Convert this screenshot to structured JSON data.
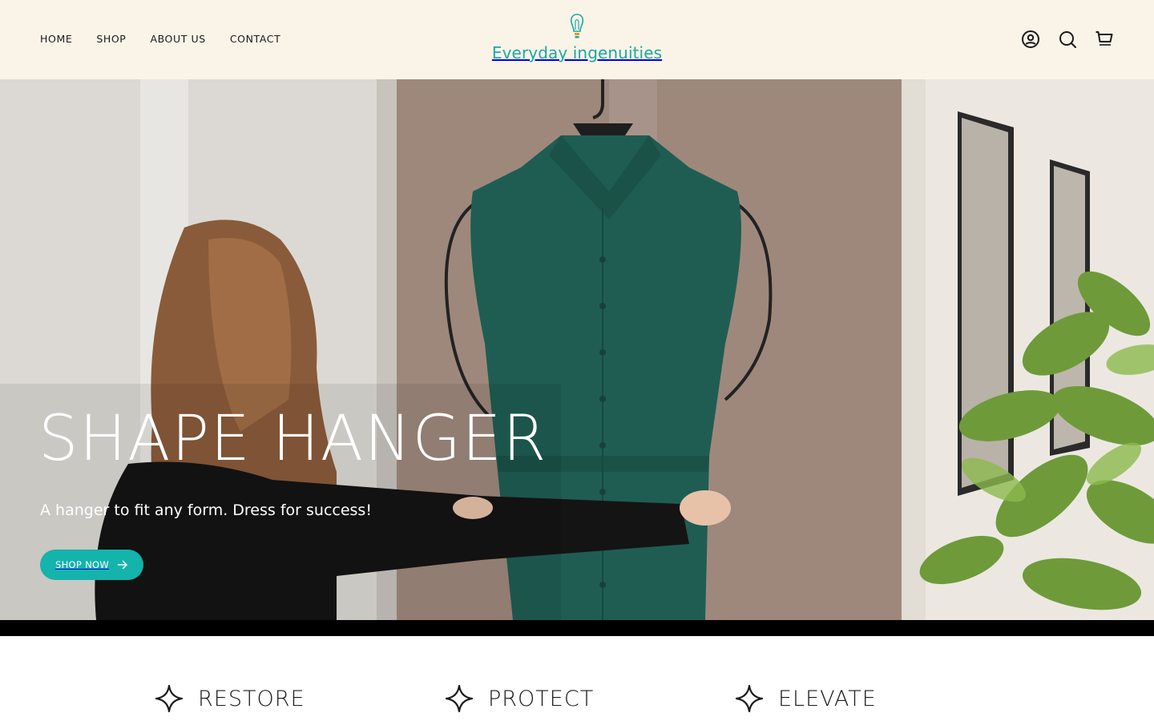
{
  "header": {
    "nav": [
      "HOME",
      "SHOP",
      "ABOUT US",
      "CONTACT"
    ],
    "logo_text": "Everyday ingenuities",
    "icons": [
      "account-icon",
      "search-icon",
      "cart-icon"
    ],
    "bg_color": "#faf3e8",
    "accent_color": "#1aa9a2"
  },
  "hero": {
    "title": "SHAPE HANGER",
    "subtitle": "A hanger to fit any form. Dress for success!",
    "cta_label": "SHOP NOW",
    "cta_color": "#14b3ab"
  },
  "features": [
    {
      "label": "RESTORE",
      "icon": "sparkle-icon"
    },
    {
      "label": "PROTECT",
      "icon": "sparkle-icon"
    },
    {
      "label": "ELEVATE",
      "icon": "sparkle-icon"
    }
  ]
}
